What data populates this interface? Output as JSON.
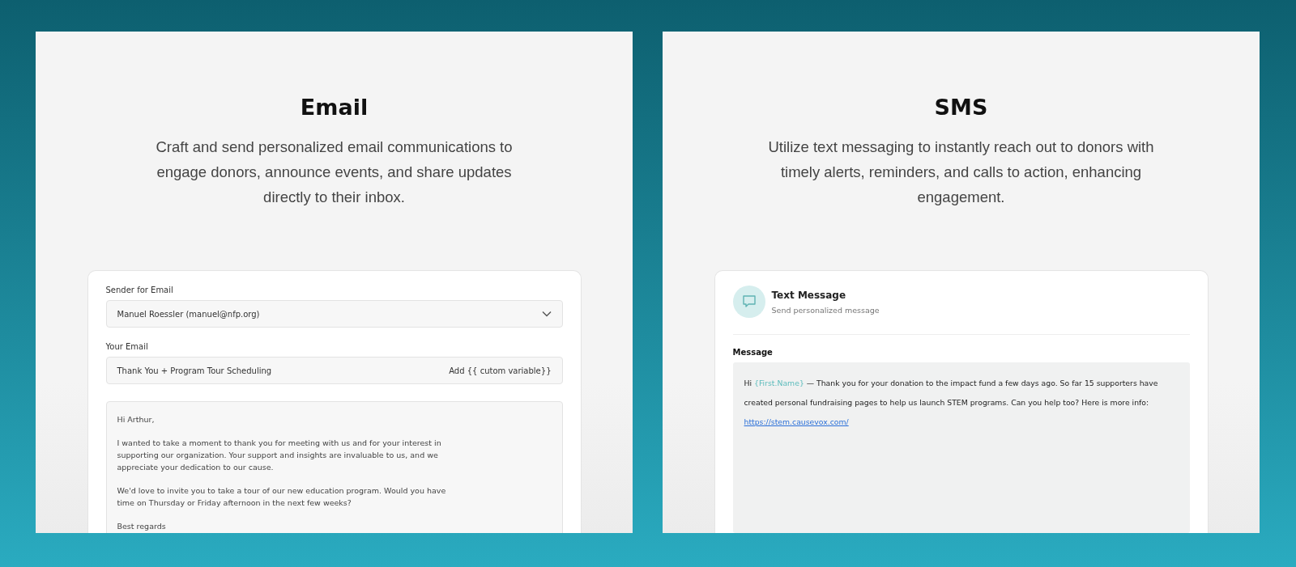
{
  "panels": [
    {
      "kind": "email",
      "title": "Email",
      "description": "Craft and send personalized email communications to engage donors, announce events, and share updates directly to their inbox.",
      "sender": {
        "label": "Sender for Email",
        "value": "Manuel Roessler (manuel@nfp.org)"
      },
      "subject": {
        "label": "Your Email",
        "value": "Thank You + Program Tour Scheduling",
        "action": "Add {{ cutom variable}}"
      },
      "body": [
        "Hi Arthur,",
        "I wanted to take a moment to thank you for meeting with us and for your interest in supporting our organization. Your support and insights are invaluable to us, and we appreciate your dedication to our cause.",
        "We'd love to invite you to take a tour of our new education program. Would you have time on Thursday or Friday afternoon in the next few weeks?",
        "Best regards"
      ]
    },
    {
      "kind": "sms",
      "title": "SMS",
      "description": "Utilize text messaging to instantly reach out to donors with timely alerts, reminders, and calls to action, enhancing engagement.",
      "header": {
        "title": "Text Message",
        "subtitle": "Send personalized message"
      },
      "message": {
        "label": "Message",
        "greeting": "Hi",
        "variable": "{First.Name}",
        "text": "— Thank you for your donation to the impact fund a few days ago. So far 15 supporters have created personal fundraising pages to help us launch STEM programs. Can you help too? Here is more info:",
        "link": "https://stem.causevox.com/"
      }
    }
  ]
}
